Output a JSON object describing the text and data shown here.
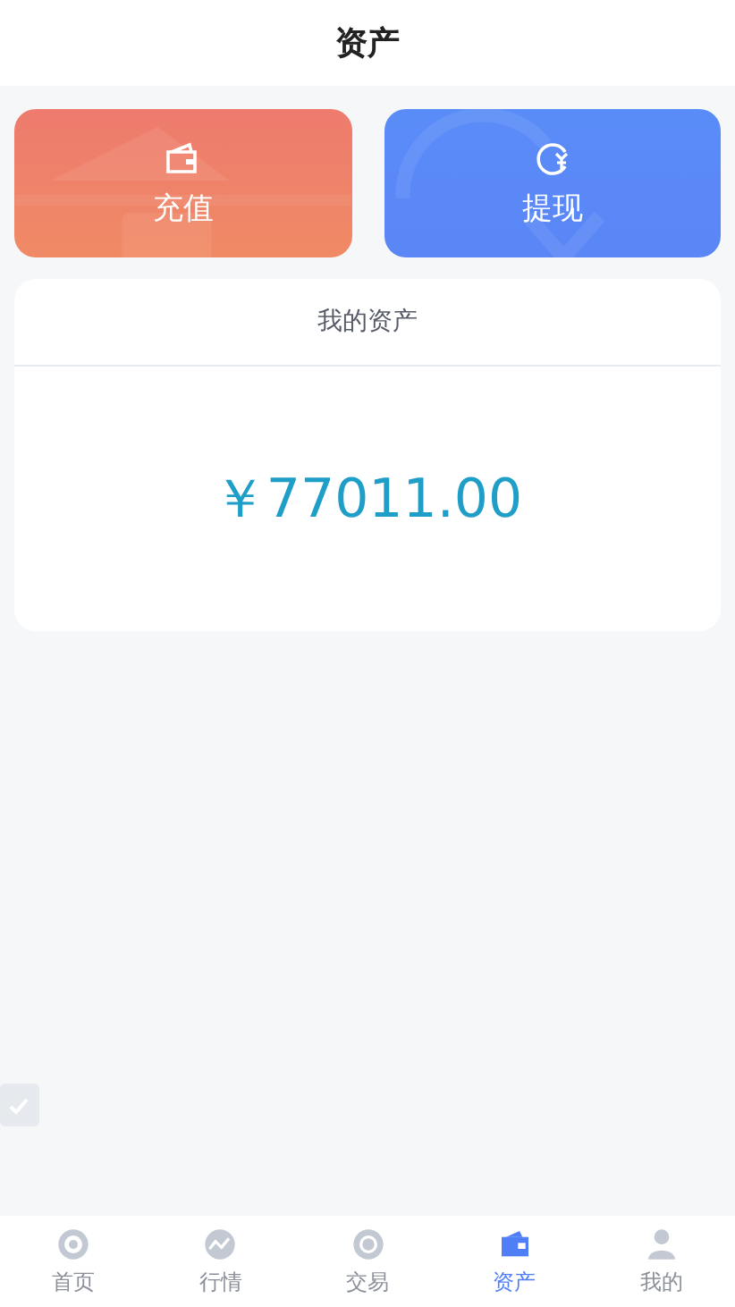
{
  "header": {
    "title": "资产"
  },
  "actions": [
    {
      "kind": "recharge",
      "label": "充值"
    },
    {
      "kind": "withdraw",
      "label": "提现"
    }
  ],
  "assets_card": {
    "title": "我的资产",
    "amount": "￥77011.00"
  },
  "tab_bar": [
    {
      "kind": "home",
      "label": "首页",
      "selected": false
    },
    {
      "kind": "market",
      "label": "行情",
      "selected": false
    },
    {
      "kind": "trade",
      "label": "交易",
      "selected": false
    },
    {
      "kind": "assets",
      "label": "资产",
      "selected": true
    },
    {
      "kind": "profile",
      "label": "我的",
      "selected": false
    }
  ]
}
